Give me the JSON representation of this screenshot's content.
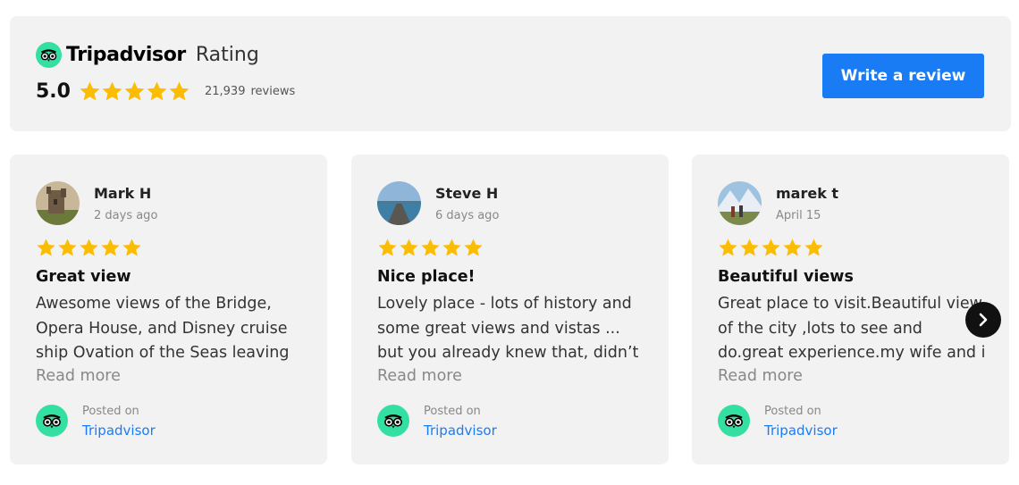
{
  "header": {
    "brand_name": "Tripadvisor",
    "brand_suffix": "Rating",
    "score": "5.0",
    "star_rating": 5,
    "review_count": "21,939",
    "review_count_label": "reviews",
    "write_review_label": "Write a review",
    "logo_icon": "tripadvisor-owl-icon"
  },
  "colors": {
    "star": "#fbbc04",
    "brand_green": "#34e0a1",
    "button_blue": "#1a7cf5",
    "panel_bg": "#f2f2f2"
  },
  "reviews": [
    {
      "name": "Mark H",
      "date": "2 days ago",
      "rating": 5,
      "title": "Great view",
      "lines": [
        "Awesome views of the Bridge,",
        "Opera House, and Disney cruise",
        "ship Ovation of the Seas leaving"
      ],
      "read_more": "Read more",
      "posted_on": "Posted on",
      "source": "Tripadvisor",
      "avatar": "castle-photo-avatar"
    },
    {
      "name": "Steve H",
      "date": "6 days ago",
      "rating": 5,
      "title": "Nice place!",
      "lines": [
        "Lovely place - lots of history and",
        "some great views and vistas ...",
        "but you already knew that, didn’t"
      ],
      "read_more": "Read more",
      "posted_on": "Posted on",
      "source": "Tripadvisor",
      "avatar": "pier-photo-avatar"
    },
    {
      "name": "marek t",
      "date": "April 15",
      "rating": 5,
      "title": "Beautiful views",
      "lines": [
        "Great place to visit.Beautiful view",
        "of the city ,lots to see and",
        "do.great experience.my wife and i"
      ],
      "read_more": "Read more",
      "posted_on": "Posted on",
      "source": "Tripadvisor",
      "avatar": "mountain-photo-avatar"
    }
  ],
  "carousel": {
    "next_icon": "chevron-right-icon"
  }
}
